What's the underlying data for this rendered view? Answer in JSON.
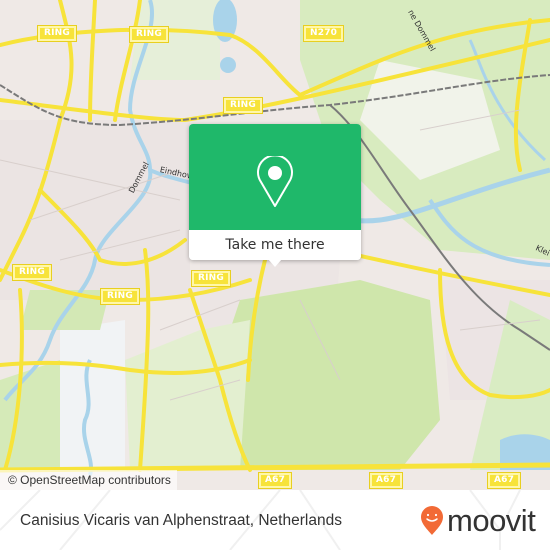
{
  "map": {
    "road_shields": [
      {
        "id": "ring-1",
        "label": "RING"
      },
      {
        "id": "ring-2",
        "label": "RING"
      },
      {
        "id": "ring-3",
        "label": "RING"
      },
      {
        "id": "ring-4",
        "label": "RING"
      },
      {
        "id": "ring-5",
        "label": "RING"
      },
      {
        "id": "ring-6",
        "label": "RING"
      },
      {
        "id": "n270",
        "label": "N270"
      },
      {
        "id": "a67-1",
        "label": "A67"
      },
      {
        "id": "a67-2",
        "label": "A67"
      },
      {
        "id": "a67-3",
        "label": "A67"
      },
      {
        "id": "a67-4",
        "label": "A67"
      }
    ],
    "street_labels": [
      {
        "id": "dommel-1",
        "label": "Dommel"
      },
      {
        "id": "eindhoven",
        "label": "Eindhov"
      },
      {
        "id": "dommel-2",
        "label": "ne Dommel"
      },
      {
        "id": "klein",
        "label": "Klei"
      }
    ],
    "colors": {
      "land": "#f2efe9",
      "residential": "#e8e0e0",
      "green": "#d4eab5",
      "water": "#a9d3ea",
      "major_road": "#f7e33a",
      "rail": "#777777"
    }
  },
  "popup": {
    "icon": "map-pin-icon",
    "button_label": "Take me there",
    "accent_color": "#1fb86a"
  },
  "attribution": {
    "text": "© OpenStreetMap contributors"
  },
  "footer": {
    "address": "Canisius Vicaris van Alphenstraat, Netherlands",
    "logo_text": "moovit",
    "logo_icon": "moovit-pin-icon",
    "logo_color": "#f26a36"
  }
}
